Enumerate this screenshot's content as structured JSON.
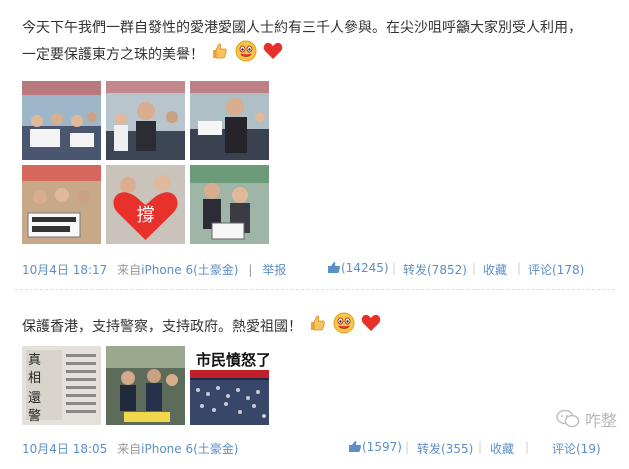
{
  "post1": {
    "line1": "今天下午我們一群自發性的愛港愛國人士約有三千人參與。在尖沙咀呼籲大家別受人利用，",
    "line2": "一定要保護東方之珠的美譽！",
    "emojis": [
      "thumbs-up-icon",
      "smiley-icon",
      "heart-icon"
    ],
    "photo_captions": [
      "",
      "",
      "",
      "",
      "撐",
      ""
    ],
    "date": "10月4日 18:17",
    "source_prefix": "来自",
    "source": "iPhone 6(土豪金)",
    "report": "举报",
    "likes": "(14245)",
    "repost": "转发(7852)",
    "favorite": "收藏",
    "comment": "评论(178)"
  },
  "post2": {
    "text": "保護香港，支持警察，支持政府。熱愛祖國！",
    "emojis": [
      "thumbs-up-icon",
      "smiley-icon",
      "heart-icon"
    ],
    "photo_captions": [
      "真相 還警察一",
      "",
      "市民憤怒了"
    ],
    "date": "10月4日 18:05",
    "source_prefix": "来自",
    "source": "iPhone 6(土豪金)",
    "likes": "(1597)",
    "repost": "转发(355)",
    "favorite": "收藏",
    "comment": "评论(19)"
  },
  "watermark": "咋整",
  "colors": {
    "link": "#5b8fc8",
    "text": "#333333",
    "muted": "#999999"
  }
}
